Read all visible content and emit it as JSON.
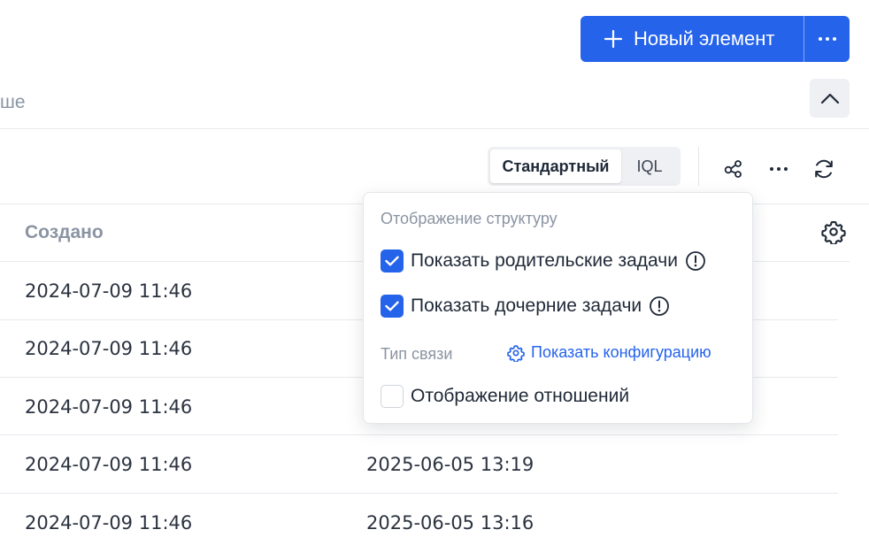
{
  "header": {
    "new_button_label": "Новый элемент",
    "more_label": "⋯",
    "cut_text": "ше"
  },
  "toolbar": {
    "view_options": [
      "Стандартный",
      "IQL"
    ],
    "selected_view": "Стандартный"
  },
  "table": {
    "column_created": "Создано",
    "rows": [
      {
        "created": "2024-07-09 11:46",
        "updated": ""
      },
      {
        "created": "2024-07-09 11:46",
        "updated": ""
      },
      {
        "created": "2024-07-09 11:46",
        "updated": ""
      },
      {
        "created": "2024-07-09 11:46",
        "updated": "2025-06-05 13:19"
      },
      {
        "created": "2024-07-09 11:46",
        "updated": "2025-06-05 13:16"
      }
    ]
  },
  "dropdown": {
    "section_title": "Отображение структуру",
    "show_parent": {
      "label": "Показать родительские задачи",
      "checked": true
    },
    "show_children": {
      "label": "Показать дочерние задачи",
      "checked": true
    },
    "link_type_label": "Тип связи",
    "show_config_link": "Показать конфигурацию",
    "show_relations": {
      "label": "Отображение отношений",
      "checked": false
    }
  },
  "colors": {
    "primary": "#2563eb",
    "muted_text": "#8a94a3"
  }
}
